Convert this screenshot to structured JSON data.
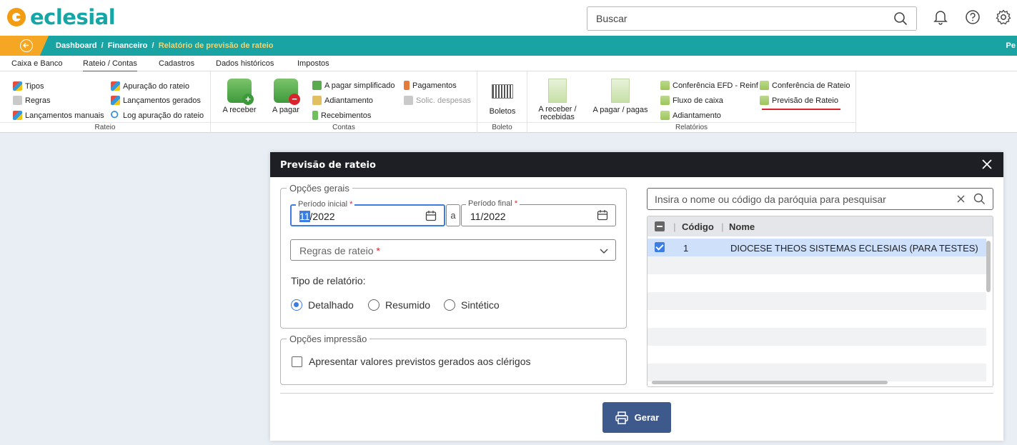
{
  "app": {
    "logo": "eclesial"
  },
  "topbar": {
    "search_placeholder": "Buscar",
    "right_cut": "Pe"
  },
  "breadcrumb": {
    "dashboard": "Dashboard",
    "sep": "/",
    "financeiro": "Financeiro",
    "current": "Relatório de previsão de rateio"
  },
  "tabs": [
    {
      "label": "Caixa e Banco"
    },
    {
      "label": "Rateio / Contas",
      "active": true
    },
    {
      "label": "Cadastros"
    },
    {
      "label": "Dados históricos"
    },
    {
      "label": "Impostos"
    }
  ],
  "ribbon": {
    "rateio": {
      "label": "Rateio",
      "items": [
        "Tipos",
        "Regras",
        "Lançamentos manuais",
        "Apuração do rateio",
        "Lançamentos gerados",
        "Log apuração do rateio"
      ]
    },
    "contas": {
      "label": "Contas",
      "a_receber": "A receber",
      "a_pagar": "A pagar",
      "a_pagar_simplificado": "A pagar simplificado",
      "adiantamento": "Adiantamento",
      "recebimentos": "Recebimentos",
      "pagamentos": "Pagamentos",
      "solic_despesas": "Solic. despesas"
    },
    "boleto": {
      "label": "Boleto",
      "boletos": "Boletos"
    },
    "relatorios": {
      "label": "Relatórios",
      "a_receber_recebidas_1": "A receber /",
      "a_receber_recebidas_2": "recebidas",
      "a_pagar_pagas": "A pagar / pagas",
      "conferencia_efd": "Conferência EFD - Reinf",
      "fluxo_caixa": "Fluxo de caixa",
      "adiantamento": "Adiantamento",
      "conferencia_rateio": "Conferência de Rateio",
      "previsao_rateio": "Previsão de Rateio"
    }
  },
  "modal": {
    "title": "Previsão de rateio",
    "opcoes_gerais": "Opções gerais",
    "periodo_inicial_label": "Período inicial",
    "periodo_inicial_sel": "11",
    "periodo_inicial_rest": "/2022",
    "a": "a",
    "periodo_final_label": "Período final",
    "periodo_final_value": "11/2022",
    "required": "*",
    "regras_placeholder": "Regras de rateio",
    "tipo_relatorio": "Tipo de relatório:",
    "radios": [
      {
        "label": "Detalhado",
        "checked": true
      },
      {
        "label": "Resumido",
        "checked": false
      },
      {
        "label": "Sintético",
        "checked": false
      }
    ],
    "opcoes_impressao": "Opções impressão",
    "checkbox_label": "Apresentar valores previstos gerados aos clérigos",
    "parish_search_placeholder": "Insira o nome ou código da paróquia para pesquisar",
    "grid": {
      "columns": [
        "Código",
        "Nome"
      ],
      "rows": [
        {
          "codigo": "1",
          "nome": "DIOCESE THEOS SISTEMAS ECLESIAIS (PARA TESTES)",
          "checked": true
        }
      ]
    },
    "gerar": "Gerar"
  }
}
